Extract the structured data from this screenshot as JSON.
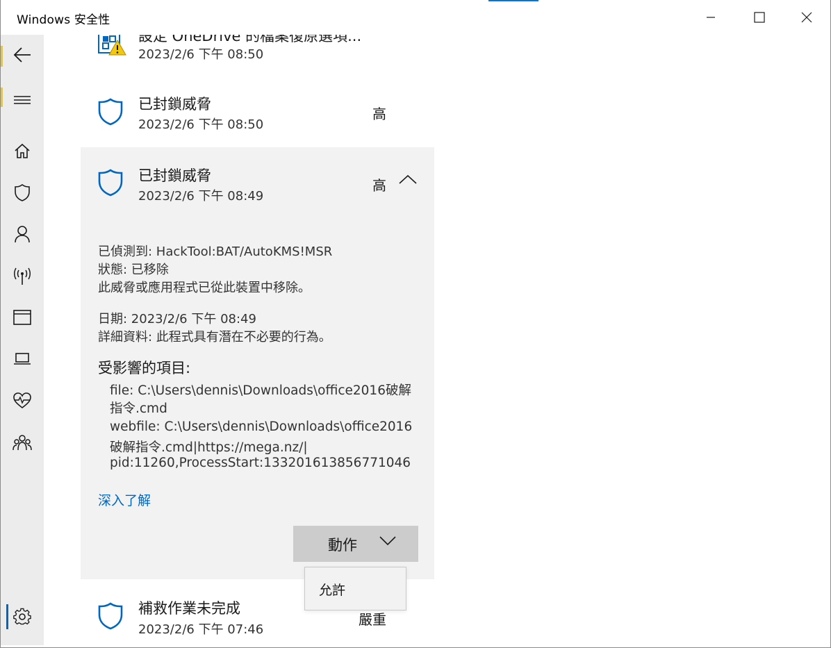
{
  "window": {
    "title": "Windows 安全性"
  },
  "sidebar": {
    "items": [
      {
        "name": "back",
        "icon": "back-arrow-icon"
      },
      {
        "name": "menu",
        "icon": "hamburger-icon"
      },
      {
        "name": "home",
        "icon": "home-icon"
      },
      {
        "name": "virus-protection",
        "icon": "shield-icon"
      },
      {
        "name": "account-protection",
        "icon": "person-icon"
      },
      {
        "name": "firewall-network",
        "icon": "antenna-icon"
      },
      {
        "name": "app-browser-control",
        "icon": "browser-window-icon"
      },
      {
        "name": "device-security",
        "icon": "laptop-icon"
      },
      {
        "name": "device-performance",
        "icon": "heart-pulse-icon"
      },
      {
        "name": "family-options",
        "icon": "family-icon"
      },
      {
        "name": "settings",
        "icon": "gear-icon"
      }
    ]
  },
  "history": {
    "partial_item": {
      "title": "設定 OneDrive 的檔案復原選項...",
      "date": "2023/2/6 下午 08:50"
    },
    "item1": {
      "title": "已封鎖威脅",
      "date": "2023/2/6 下午 08:50",
      "severity": "高"
    },
    "item2": {
      "title": "已封鎖威脅",
      "date": "2023/2/6 下午 08:49",
      "severity": "高",
      "details": {
        "detected": "已偵測到:  HackTool:BAT/AutoKMS!MSR",
        "status": "狀態:  已移除",
        "status_desc": "此威脅或應用程式已從此裝置中移除。",
        "date": "日期:  2023/2/6 下午 08:49",
        "info": "詳細資料:  此程式具有潛在不必要的行為。",
        "affected_heading": "受影響的項目:",
        "affected_lines": [
          "file: C:\\Users\\dennis\\Downloads\\office2016破解",
          "指令.cmd",
          "webfile: C:\\Users\\dennis\\Downloads\\office2016",
          "破解指令.cmd|https://mega.nz/|",
          "pid:11260,ProcessStart:133201613856771046"
        ],
        "learn_more": "深入了解",
        "action_label": "動作"
      }
    },
    "item3": {
      "title": "補救作業未完成",
      "date": "2023/2/6 下午 07:46",
      "severity": "嚴重"
    }
  },
  "dropdown": {
    "allow": "允許"
  },
  "colors": {
    "accent": "#0067c0",
    "shield_blue": "#0067c0",
    "warning_yellow": "#f2c811"
  }
}
